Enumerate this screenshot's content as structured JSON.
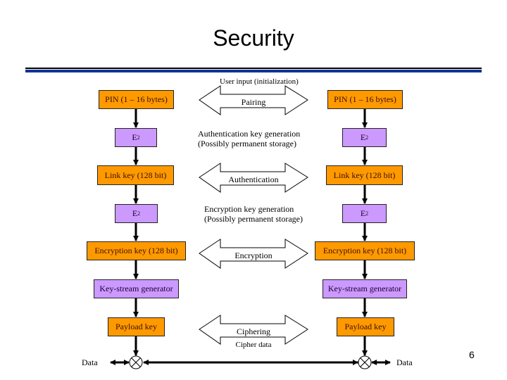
{
  "title": "Security",
  "page_number": "6",
  "colors": {
    "orange": "#ff9900",
    "purple": "#cc99ff",
    "rule_blue": "#0f3494"
  },
  "top_label": "User input (initialization)",
  "left_column": {
    "pin": "PIN (1 – 16 bytes)",
    "e2a_base": "E",
    "e2a_sub": "2",
    "link_key": "Link key (128 bit)",
    "e2b_base": "E",
    "e2b_sub": "2",
    "enc_key": "Encryption key (128 bit)",
    "keystream": "Key-stream generator",
    "payload": "Payload key",
    "data": "Data"
  },
  "right_column": {
    "pin": "PIN (1 – 16 bytes)",
    "e2a_base": "E",
    "e2a_sub": "2",
    "link_key": "Link key (128 bit)",
    "e2b_base": "E",
    "e2b_sub": "2",
    "enc_key": "Encryption key (128 bit)",
    "keystream": "Key-stream generator",
    "payload": "Payload key",
    "data": "Data"
  },
  "middle": {
    "pairing": "Pairing",
    "auth_gen_line1": "Authentication key generation",
    "auth_gen_line2": "(Possibly permanent storage)",
    "authentication": "Authentication",
    "enc_gen_line1": "Encryption key generation",
    "enc_gen_line2": "(Possibly permanent storage)",
    "encryption": "Encryption",
    "ciphering": "Ciphering",
    "cipher_data": "Cipher data"
  }
}
